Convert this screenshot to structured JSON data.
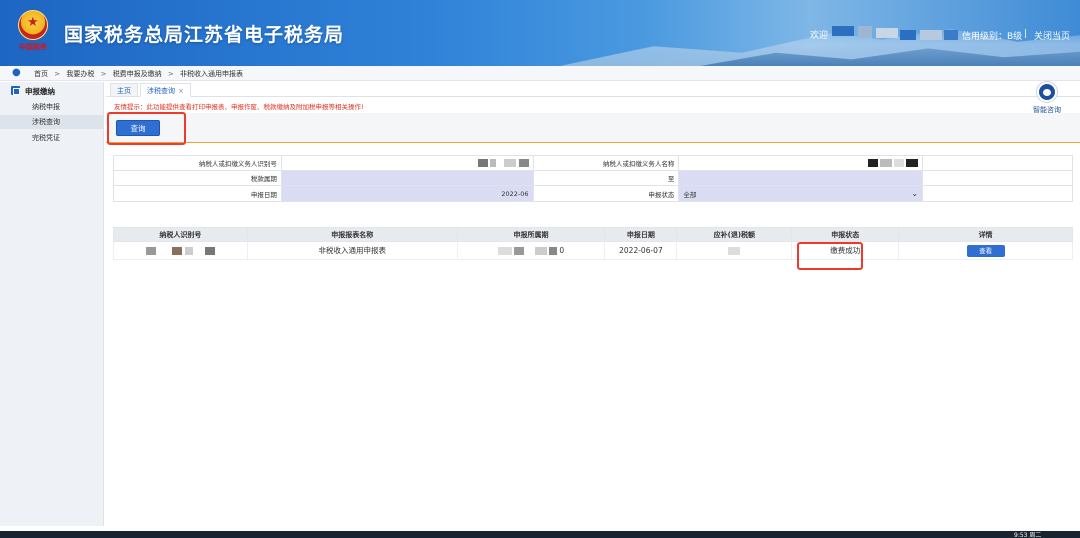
{
  "header": {
    "site_title": "国家税务总局江苏省电子税务局",
    "emblem_sub": "中国税务",
    "welcome": "欢迎",
    "credit_level": "信用级别：B级",
    "separator": "|",
    "close_page": "关闭当页"
  },
  "breadcrumb": {
    "items": [
      "首页",
      "我要办税",
      "税费申报及缴纳",
      "非税收入通用申报表"
    ],
    "arrow": ">"
  },
  "sidebar": {
    "section_title": "申报缴纳",
    "items": [
      {
        "label": "纳税申报"
      },
      {
        "label": "涉税查询"
      },
      {
        "label": "完税凭证"
      }
    ]
  },
  "tabs": {
    "home": "主页",
    "active": "涉税查询",
    "close": "×"
  },
  "tip": "友情提示：此功能提供查看打印申报表、申报作废、税款缴纳及附加税申报等相关操作!",
  "query_button": "查询",
  "smart_consult": "智能咨询",
  "form": {
    "taxpayer_id_label": "纳税人或扣缴义务人识别号",
    "taxpayer_name_label": "纳税人或扣缴义务人名称",
    "period_label": "税款属期",
    "to_label": "至",
    "declare_date_label": "申报日期",
    "declare_date_value": "2022-06",
    "status_label": "申报状态",
    "status_value": "全部"
  },
  "table": {
    "headers": [
      "纳税人识别号",
      "申报报表名称",
      "申报所属期",
      "申报日期",
      "应补(退)税额",
      "申报状态",
      "详情"
    ],
    "rows": [
      {
        "report_name": "非税收入通用申报表",
        "period_suffix": "0",
        "declare_date": "2022-06-07",
        "status": "缴费成功",
        "detail_button": "查看"
      }
    ]
  },
  "taskbar": {
    "clock": "9:53 周二"
  },
  "colors": {
    "header_blue": "#1d66c3",
    "button_blue": "#2f6fd1",
    "highlight_red": "#ee3a2a",
    "tip_red": "#e0301e",
    "input_purple": "#d9dcf3"
  }
}
